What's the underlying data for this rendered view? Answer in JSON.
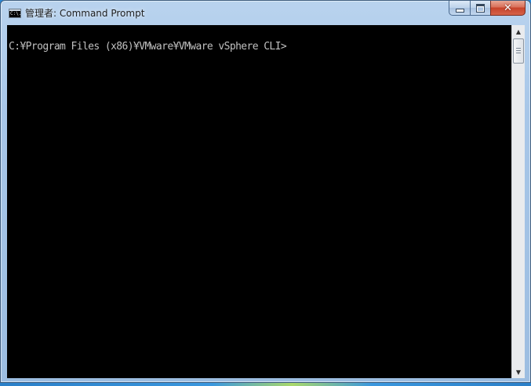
{
  "window": {
    "title": "管理者: Command Prompt",
    "icon": "console-icon",
    "icon_text": "C:\\."
  },
  "caption": {
    "minimize_icon": "minimize-icon",
    "maximize_icon": "maximize-icon",
    "close_icon": "close-icon",
    "close_glyph": "✕"
  },
  "console": {
    "lines": [
      "C:¥Program Files (x86)¥VMware¥VMware vSphere CLI>"
    ],
    "background": "#000000",
    "foreground": "#c0c0c0"
  },
  "scrollbar": {
    "up_arrow": "▲",
    "down_arrow": "▼"
  }
}
